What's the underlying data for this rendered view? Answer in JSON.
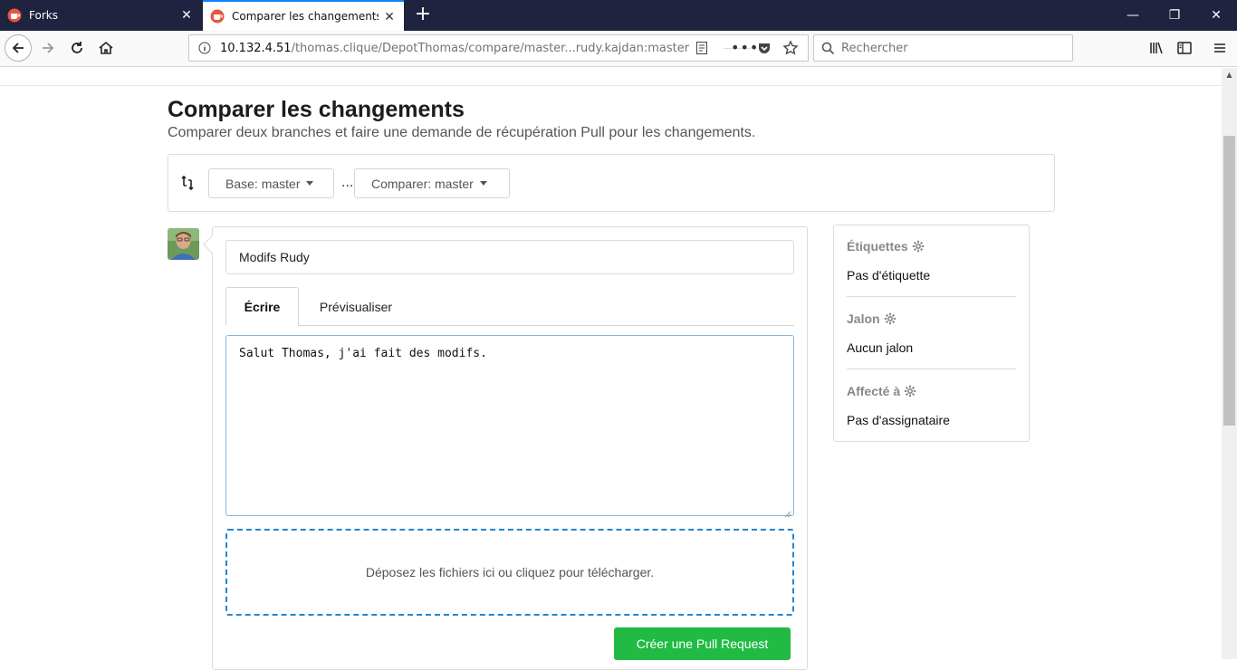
{
  "browser": {
    "tabs": [
      {
        "title": "Forks"
      },
      {
        "title": "Comparer les changements - G"
      }
    ],
    "url": {
      "host": "10.132.4.51",
      "path": "/thomas.clique/DepotThomas/compare/master...rudy.kajdan:master"
    },
    "search_placeholder": "Rechercher",
    "icons": [
      "back-icon",
      "forward-icon",
      "reload-icon",
      "home-icon",
      "info-icon",
      "reader-view-icon",
      "page-actions-icon",
      "pocket-icon",
      "bookmark-star-icon",
      "search-icon",
      "library-icon",
      "sidebar-icon",
      "menu-icon"
    ]
  },
  "page": {
    "title": "Comparer les changements",
    "subtitle": "Comparer deux branches et faire une demande de récupération Pull pour les changements.",
    "branches": {
      "base_label": "Base: master",
      "separator": "...",
      "compare_label": "Comparer: master"
    },
    "form": {
      "title_value": "Modifs Rudy",
      "tabs": [
        {
          "label": "Écrire",
          "active": true
        },
        {
          "label": "Prévisualiser",
          "active": false
        }
      ],
      "body_value": "Salut Thomas, j'ai fait des modifs.",
      "dropzone_text": "Déposez les fichiers ici ou cliquez pour télécharger.",
      "submit_label": "Créer une Pull Request"
    },
    "sidebar": {
      "labels": {
        "heading": "Étiquettes",
        "value": "Pas d'étiquette"
      },
      "milestone": {
        "heading": "Jalon",
        "value": "Aucun jalon"
      },
      "assignee": {
        "heading": "Affecté à",
        "value": "Pas d'assignataire"
      }
    }
  },
  "colors": {
    "tabbar": "#202340",
    "accent_blue": "#2185d0",
    "submit_green": "#21ba45",
    "gitea_logo": "#e8563f"
  }
}
